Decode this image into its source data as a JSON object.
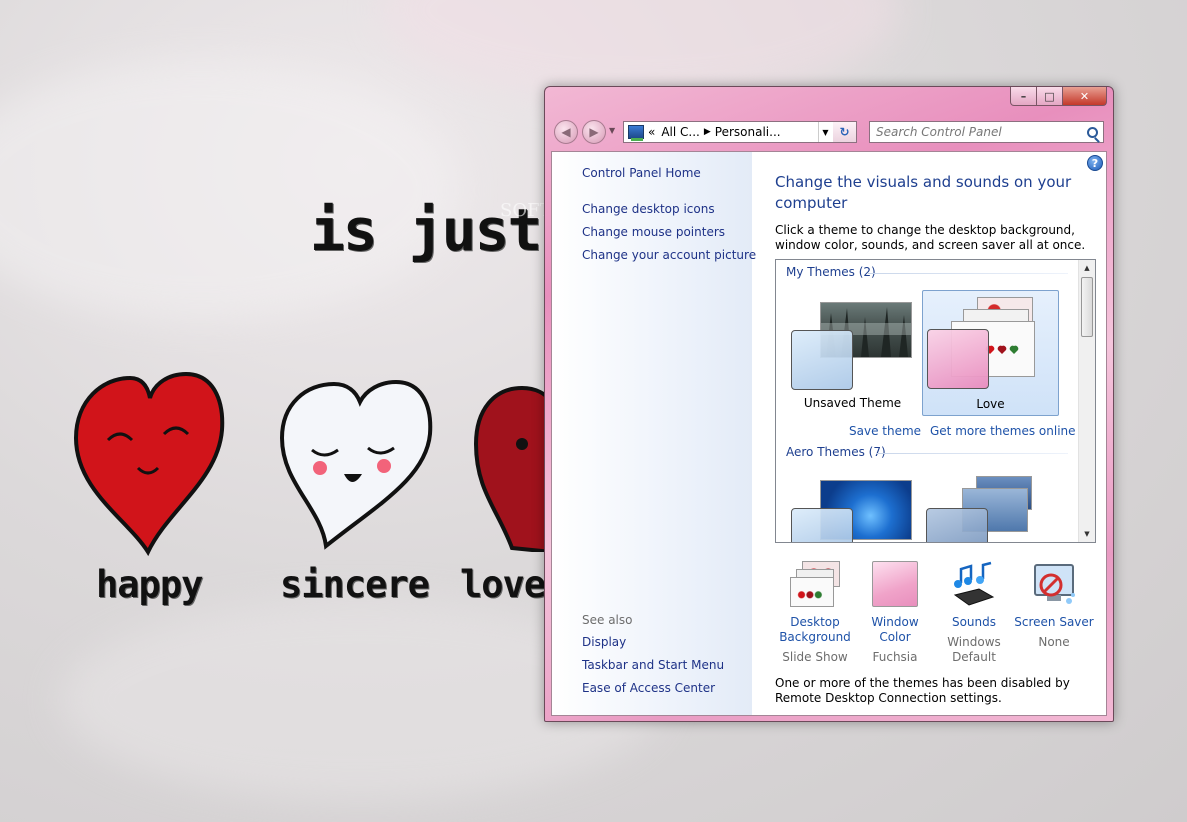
{
  "desktop": {
    "tagline": "is just !",
    "watermark": "SOFTPEDIA",
    "words": [
      "happy",
      "sincere",
      "lover"
    ]
  },
  "window": {
    "buttons": {
      "minimize": "–",
      "maximize": "□",
      "close": "✕"
    },
    "address": {
      "chevron": "«",
      "crumbs": [
        "All C...",
        "Personali..."
      ]
    },
    "search_placeholder": "Search Control Panel",
    "colors": {
      "accent": "#e88fbd",
      "link": "#1e3287",
      "heading": "#1e3f8f"
    }
  },
  "sidebar": {
    "home": "Control Panel Home",
    "links": [
      "Change desktop icons",
      "Change mouse pointers",
      "Change your account picture"
    ],
    "see_also_label": "See also",
    "see_also": [
      "Display",
      "Taskbar and Start Menu",
      "Ease of Access Center"
    ]
  },
  "main": {
    "help": "?",
    "title": "Change the visuals and sounds on your computer",
    "description": "Click a theme to change the desktop background, window color, sounds, and screen saver all at once.",
    "my_themes": {
      "header": "My Themes (2)",
      "items": [
        {
          "label": "Unsaved Theme",
          "selected": false
        },
        {
          "label": "Love",
          "selected": true
        }
      ],
      "save_theme": "Save theme",
      "get_more": "Get more themes online"
    },
    "aero_themes": {
      "header": "Aero Themes (7)"
    },
    "tiles": [
      {
        "label": "Desktop Background",
        "value": "Slide Show",
        "icon": "desktop-background-icon"
      },
      {
        "label": "Window Color",
        "value": "Fuchsia",
        "icon": "window-color-icon"
      },
      {
        "label": "Sounds",
        "value": "Windows Default",
        "icon": "sounds-icon"
      },
      {
        "label": "Screen Saver",
        "value": "None",
        "icon": "screen-saver-icon"
      }
    ],
    "notice": "One or more of the themes has been disabled by Remote Desktop Connection settings."
  }
}
